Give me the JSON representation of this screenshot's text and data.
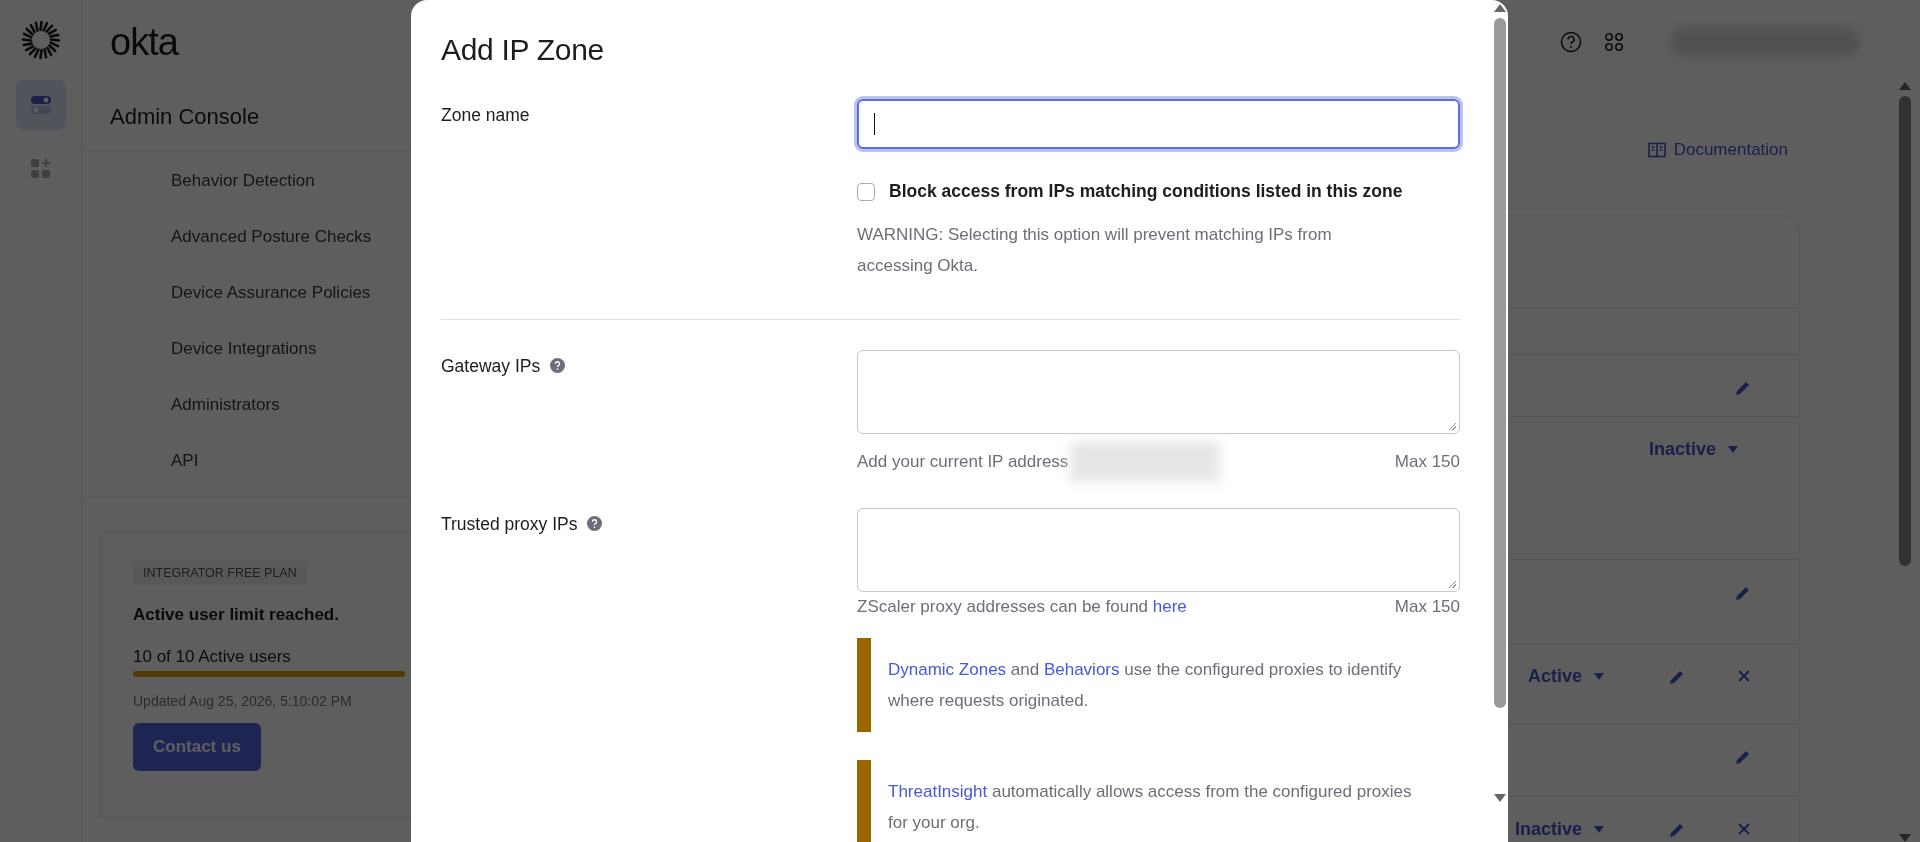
{
  "brand": {
    "wordmark": "okta"
  },
  "rail": {
    "items": [
      {
        "kind": "toggles",
        "selected": true
      },
      {
        "kind": "apps",
        "selected": false
      }
    ]
  },
  "sidebar": {
    "title": "Admin Console",
    "items": [
      "Behavior Detection",
      "Advanced Posture Checks",
      "Device Assurance Policies",
      "Device Integrations",
      "Administrators",
      "API"
    ]
  },
  "plan": {
    "badge": "INTEGRATOR FREE PLAN",
    "heading": "Active user limit reached.",
    "usage": "10 of 10 Active users",
    "level": 1,
    "updated": "Updated Aug 25, 2026, 5:10:02 PM",
    "button": "Contact us"
  },
  "page": {
    "documentation_link": "Documentation",
    "rows": [
      {
        "edit": false,
        "remove": false
      },
      {
        "edit": true,
        "remove": false
      },
      {
        "status": "Inactive",
        "edit": false,
        "remove": false
      },
      {
        "edit": true,
        "remove": false
      },
      {
        "status": "Active",
        "edit": true,
        "remove": true
      },
      {
        "edit": true,
        "remove": false
      },
      {
        "status": "Inactive",
        "edit": true,
        "remove": true
      }
    ]
  },
  "modal": {
    "title": "Add IP Zone",
    "zone_name": {
      "label": "Zone name",
      "focused": true
    },
    "block_access": {
      "label": "Block access from IPs matching conditions listed in this zone",
      "checked": false,
      "warning": "WARNING: Selecting this option will prevent matching IPs from accessing Okta."
    },
    "gateway": {
      "label": "Gateway IPs",
      "hint": "Add your current IP address",
      "max": "Max 150"
    },
    "proxy": {
      "label": "Trusted proxy IPs",
      "hint": [
        {
          "kind": "text",
          "text": "ZScaler proxy addresses can be found "
        },
        {
          "kind": "link",
          "text": "here"
        }
      ],
      "max": "Max 150"
    },
    "callouts": [
      [
        {
          "kind": "link",
          "text": "Dynamic Zones"
        },
        {
          "kind": "text",
          "text": " and "
        },
        {
          "kind": "link",
          "text": "Behaviors"
        },
        {
          "kind": "text",
          "text": " use the configured proxies to identify where requests originated."
        }
      ],
      [
        {
          "kind": "link",
          "text": "ThreatInsight"
        },
        {
          "kind": "text",
          "text": " automatically allows access from the configured proxies for your org."
        }
      ]
    ]
  }
}
